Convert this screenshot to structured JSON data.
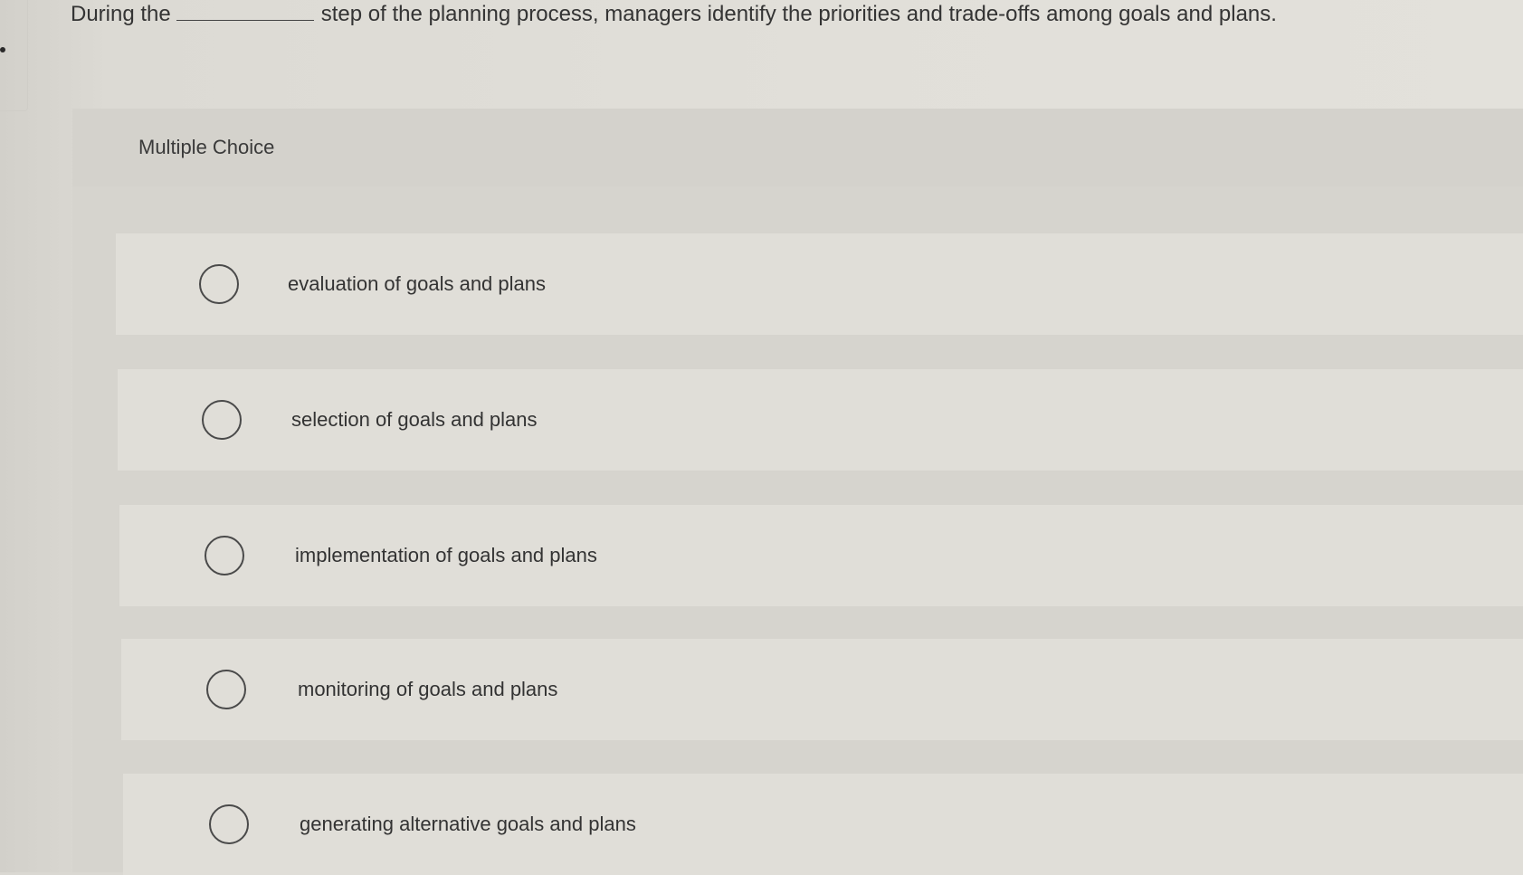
{
  "question": {
    "before_blank": "During the",
    "after_blank": "step of the planning process, managers identify the priorities and trade-offs among goals and plans."
  },
  "multiple_choice": {
    "header": "Multiple Choice",
    "options": [
      {
        "label": "evaluation of goals and plans",
        "selected": false
      },
      {
        "label": "selection of goals and plans",
        "selected": false
      },
      {
        "label": "implementation of goals and plans",
        "selected": false
      },
      {
        "label": "monitoring of goals and plans",
        "selected": false
      },
      {
        "label": "generating alternative goals and plans",
        "selected": false
      }
    ]
  }
}
